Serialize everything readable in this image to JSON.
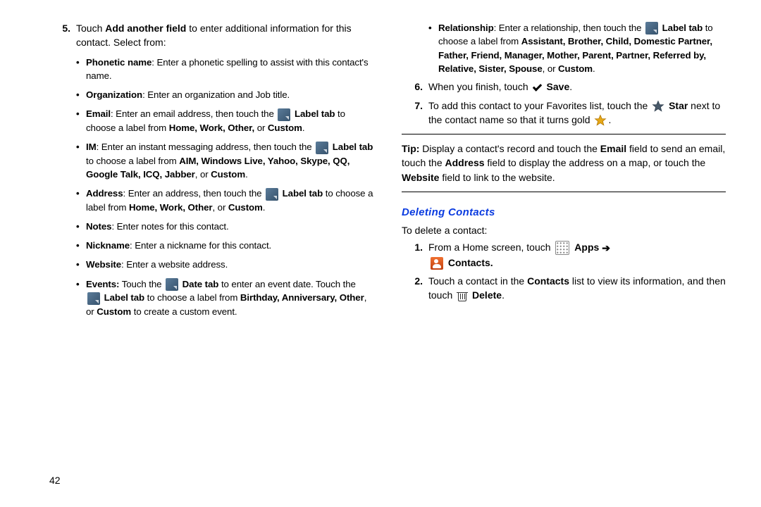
{
  "pagenum": "42",
  "left": {
    "step5": {
      "num": "5.",
      "intro_a": "Touch ",
      "intro_bold": "Add another field",
      "intro_b": " to enter additional information for this contact. Select from:",
      "bullets": {
        "phon_label": "Phonetic name",
        "phon_text": ": Enter a phonetic spelling to assist with this contact's name.",
        "org_label": "Organization",
        "org_text": ": Enter an organization and Job title.",
        "email_label": "Email",
        "email_a": ": Enter an email address, then touch the ",
        "email_labeltab": "Label tab",
        "email_b": " to choose a label from ",
        "email_opts": "Home, Work, Other, ",
        "email_or": "or ",
        "email_custom": "Custom",
        "im_label": "IM",
        "im_a": ": Enter an instant messaging address, then touch the ",
        "im_labeltab": "Label tab",
        "im_b": " to choose a label from ",
        "im_opts": "AIM, Windows Live, Yahoo, Skype, QQ, Google Talk, ICQ, Jabber",
        "im_or": ", or ",
        "im_custom": "Custom",
        "addr_label": "Address",
        "addr_a": ": Enter an address, then touch the ",
        "addr_labeltab": "Label tab",
        "addr_b": " to choose a label from ",
        "addr_opts": "Home, Work, Other",
        "addr_or": ", or ",
        "addr_custom": "Custom",
        "notes_label": "Notes",
        "notes_text": ": Enter notes for this contact.",
        "nick_label": "Nickname",
        "nick_text": ": Enter a nickname for this contact.",
        "web_label": "Website",
        "web_text": ": Enter a website address.",
        "ev_label": "Events:",
        "ev_a": " Touch the ",
        "ev_datetab": "Date tab",
        "ev_b": " to enter an event date. Touch the ",
        "ev_labeltab": "Label tab",
        "ev_c": " to choose a label from ",
        "ev_opts": "Birthday, Anniversary, Other",
        "ev_or": ", or ",
        "ev_custom": "Custom",
        "ev_d": " to create a custom event."
      }
    }
  },
  "right": {
    "rel_label": "Relationship",
    "rel_a": ": Enter a relationship, then touch the ",
    "rel_labeltab": "Label tab",
    "rel_b": " to choose a label from ",
    "rel_opts": "Assistant, Brother, Child, Domestic Partner, Father, Friend, Manager, Mother, Parent, Partner, Referred by, Relative, Sister, Spouse",
    "rel_or": ", or ",
    "rel_custom": "Custom",
    "step6_num": "6.",
    "step6_a": "When you finish, touch ",
    "step6_save": "Save",
    "step7_num": "7.",
    "step7_a": "To add this contact to your Favorites list, touch the ",
    "step7_star": "Star",
    "step7_b": " next to the contact name so that it turns gold ",
    "tip_label": "Tip:",
    "tip_a": " Display a contact's record and touch the ",
    "tip_email": "Email",
    "tip_b": " field to send an email, touch the ",
    "tip_addr": "Address",
    "tip_c": " field to display the address on a map, or touch the ",
    "tip_web": "Website",
    "tip_d": " field to link to the website.",
    "heading": "Deleting Contacts",
    "del_intro": "To delete a contact:",
    "d1_num": "1.",
    "d1_a": "From a Home screen, touch ",
    "d1_apps": "Apps",
    "d1_arrow": "➔",
    "d1_contacts": "Contacts.",
    "d2_num": "2.",
    "d2_a": "Touch a contact in the ",
    "d2_contacts_b": "Contacts",
    "d2_b": " list to view its information, and then touch ",
    "d2_del": "Delete"
  }
}
